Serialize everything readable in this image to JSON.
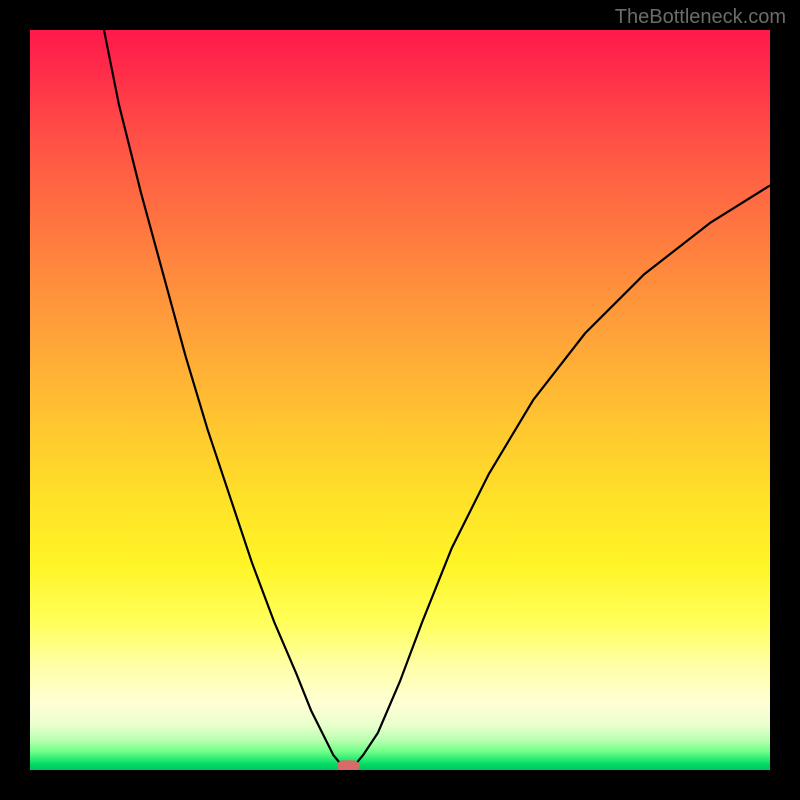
{
  "watermark": "TheBottleneck.com",
  "chart_data": {
    "type": "line",
    "title": "",
    "xlabel": "",
    "ylabel": "",
    "xlim": [
      0,
      100
    ],
    "ylim": [
      0,
      100
    ],
    "grid": false,
    "series": [
      {
        "name": "curve",
        "x": [
          10,
          12,
          15,
          18,
          21,
          24,
          27,
          30,
          33,
          36,
          38,
          40,
          41,
          42,
          43,
          44,
          45,
          47,
          50,
          53,
          57,
          62,
          68,
          75,
          83,
          92,
          100
        ],
        "y": [
          100,
          90,
          78,
          67,
          56,
          46,
          37,
          28,
          20,
          13,
          8,
          4,
          2,
          0.8,
          0.5,
          0.8,
          2,
          5,
          12,
          20,
          30,
          40,
          50,
          59,
          67,
          74,
          79
        ]
      }
    ],
    "marker": {
      "x_center": 43,
      "y": 0.5,
      "width": 3
    },
    "gradient": {
      "top_color": "#ff1a4a",
      "mid_color": "#fff426",
      "bottom_color": "#00c858"
    }
  }
}
